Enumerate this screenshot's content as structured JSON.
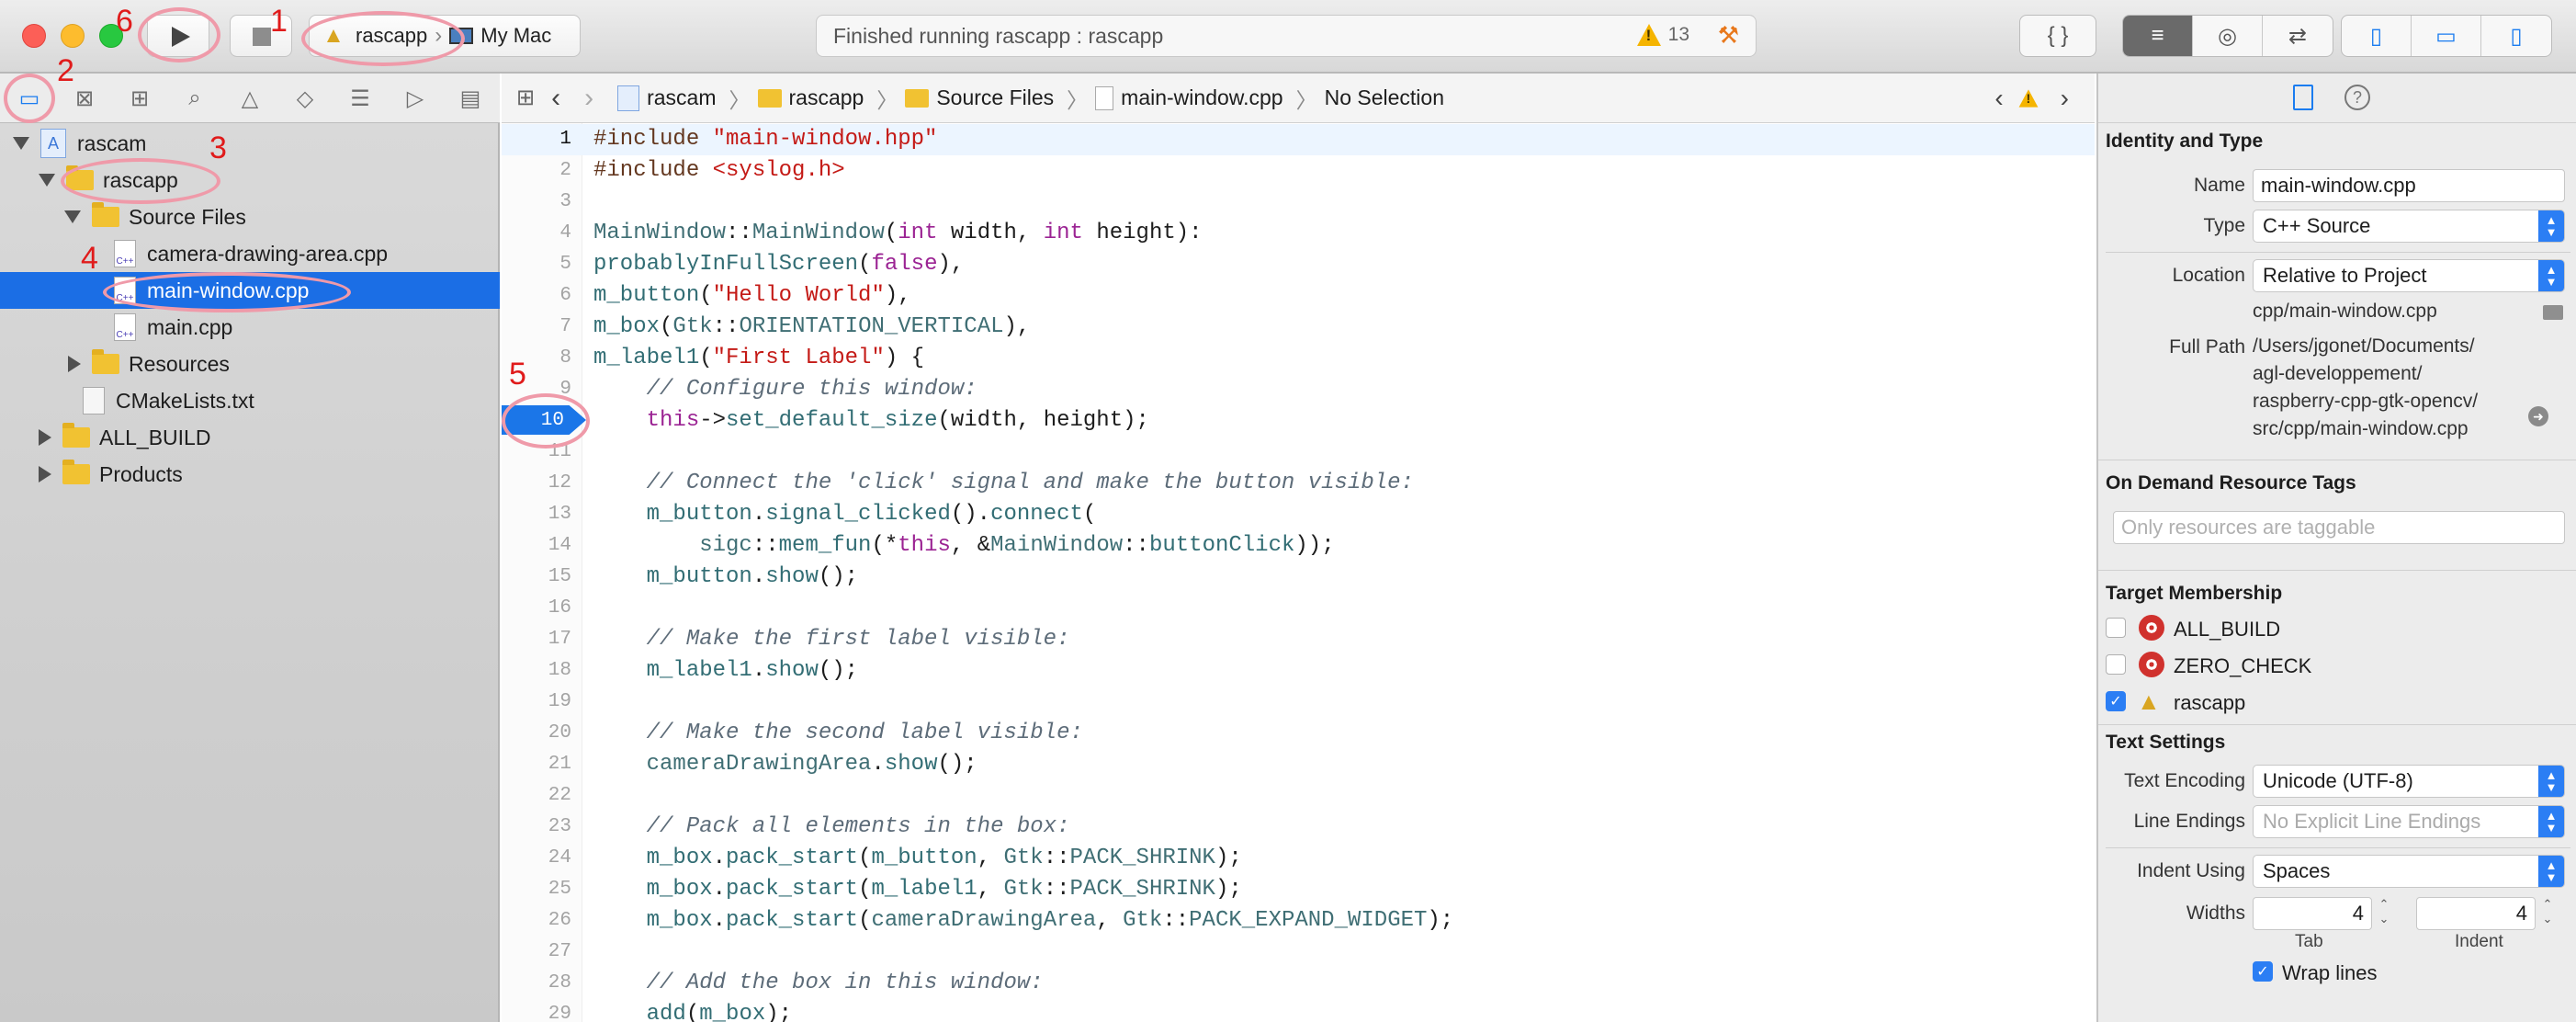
{
  "toolbar": {
    "scheme": "rascapp",
    "device": "My Mac",
    "status": "Finished running rascapp : rascapp",
    "warnings": "13",
    "editor_buttons": [
      "{ }"
    ],
    "annotations": {
      "run": "6",
      "scheme": "1"
    }
  },
  "navigator": {
    "annotations": {
      "files": "2",
      "group": "3",
      "file": "4"
    },
    "items": [
      {
        "label": "rascam"
      },
      {
        "label": "rascapp"
      },
      {
        "label": "Source Files"
      },
      {
        "label": "camera-drawing-area.cpp"
      },
      {
        "label": "main-window.cpp"
      },
      {
        "label": "main.cpp"
      },
      {
        "label": "Resources"
      },
      {
        "label": "CMakeLists.txt"
      },
      {
        "label": "ALL_BUILD"
      },
      {
        "label": "Products"
      }
    ]
  },
  "jumpbar": {
    "items": [
      "rascam",
      "rascapp",
      "Source Files",
      "main-window.cpp",
      "No Selection"
    ]
  },
  "editor": {
    "breakpoint_annotation": "5",
    "breakpoint_line": "10",
    "lines": [
      {
        "n": "1",
        "t": "#include \"main-window.hpp\""
      },
      {
        "n": "2",
        "t": "#include <syslog.h>"
      },
      {
        "n": "3",
        "t": ""
      },
      {
        "n": "4",
        "t": "MainWindow::MainWindow(int width, int height):"
      },
      {
        "n": "5",
        "t": "probablyInFullScreen(false),"
      },
      {
        "n": "6",
        "t": "m_button(\"Hello World\"),"
      },
      {
        "n": "7",
        "t": "m_box(Gtk::ORIENTATION_VERTICAL),"
      },
      {
        "n": "8",
        "t": "m_label1(\"First Label\") {"
      },
      {
        "n": "9",
        "t": "    // Configure this window:"
      },
      {
        "n": "10",
        "t": "    this->set_default_size(width, height);"
      },
      {
        "n": "11",
        "t": ""
      },
      {
        "n": "12",
        "t": "    // Connect the 'click' signal and make the button visible:"
      },
      {
        "n": "13",
        "t": "    m_button.signal_clicked().connect("
      },
      {
        "n": "14",
        "t": "        sigc::mem_fun(*this, &MainWindow::buttonClick));"
      },
      {
        "n": "15",
        "t": "    m_button.show();"
      },
      {
        "n": "16",
        "t": ""
      },
      {
        "n": "17",
        "t": "    // Make the first label visible:"
      },
      {
        "n": "18",
        "t": "    m_label1.show();"
      },
      {
        "n": "19",
        "t": ""
      },
      {
        "n": "20",
        "t": "    // Make the second label visible:"
      },
      {
        "n": "21",
        "t": "    cameraDrawingArea.show();"
      },
      {
        "n": "22",
        "t": ""
      },
      {
        "n": "23",
        "t": "    // Pack all elements in the box:"
      },
      {
        "n": "24",
        "t": "    m_box.pack_start(m_button, Gtk::PACK_SHRINK);"
      },
      {
        "n": "25",
        "t": "    m_box.pack_start(m_label1, Gtk::PACK_SHRINK);"
      },
      {
        "n": "26",
        "t": "    m_box.pack_start(cameraDrawingArea, Gtk::PACK_EXPAND_WIDGET);"
      },
      {
        "n": "27",
        "t": ""
      },
      {
        "n": "28",
        "t": "    // Add the box in this window:"
      },
      {
        "n": "29",
        "t": "    add(m_box);"
      }
    ]
  },
  "inspector": {
    "identity_title": "Identity and Type",
    "name_label": "Name",
    "name_value": "main-window.cpp",
    "type_label": "Type",
    "type_value": "C++ Source",
    "location_label": "Location",
    "location_value": "Relative to Project",
    "location_path": "cpp/main-window.cpp",
    "fullpath_label": "Full Path",
    "fullpath_lines": [
      "/Users/jgonet/Documents/",
      "agl-developpement/",
      "raspberry-cpp-gtk-opencv/",
      "src/cpp/main-window.cpp"
    ],
    "tags_title": "On Demand Resource Tags",
    "tags_placeholder": "Only resources are taggable",
    "membership_title": "Target Membership",
    "targets": [
      {
        "label": "ALL_BUILD",
        "checked": false
      },
      {
        "label": "ZERO_CHECK",
        "checked": false
      },
      {
        "label": "rascapp",
        "checked": true
      }
    ],
    "text_title": "Text Settings",
    "encoding_label": "Text Encoding",
    "encoding_value": "Unicode (UTF-8)",
    "endings_label": "Line Endings",
    "endings_value": "No Explicit Line Endings",
    "indent_label": "Indent Using",
    "indent_value": "Spaces",
    "widths_label": "Widths",
    "tab_value": "4",
    "indent_width_value": "4",
    "tab_caption": "Tab",
    "indent_caption": "Indent",
    "wrap_label": "Wrap lines"
  }
}
